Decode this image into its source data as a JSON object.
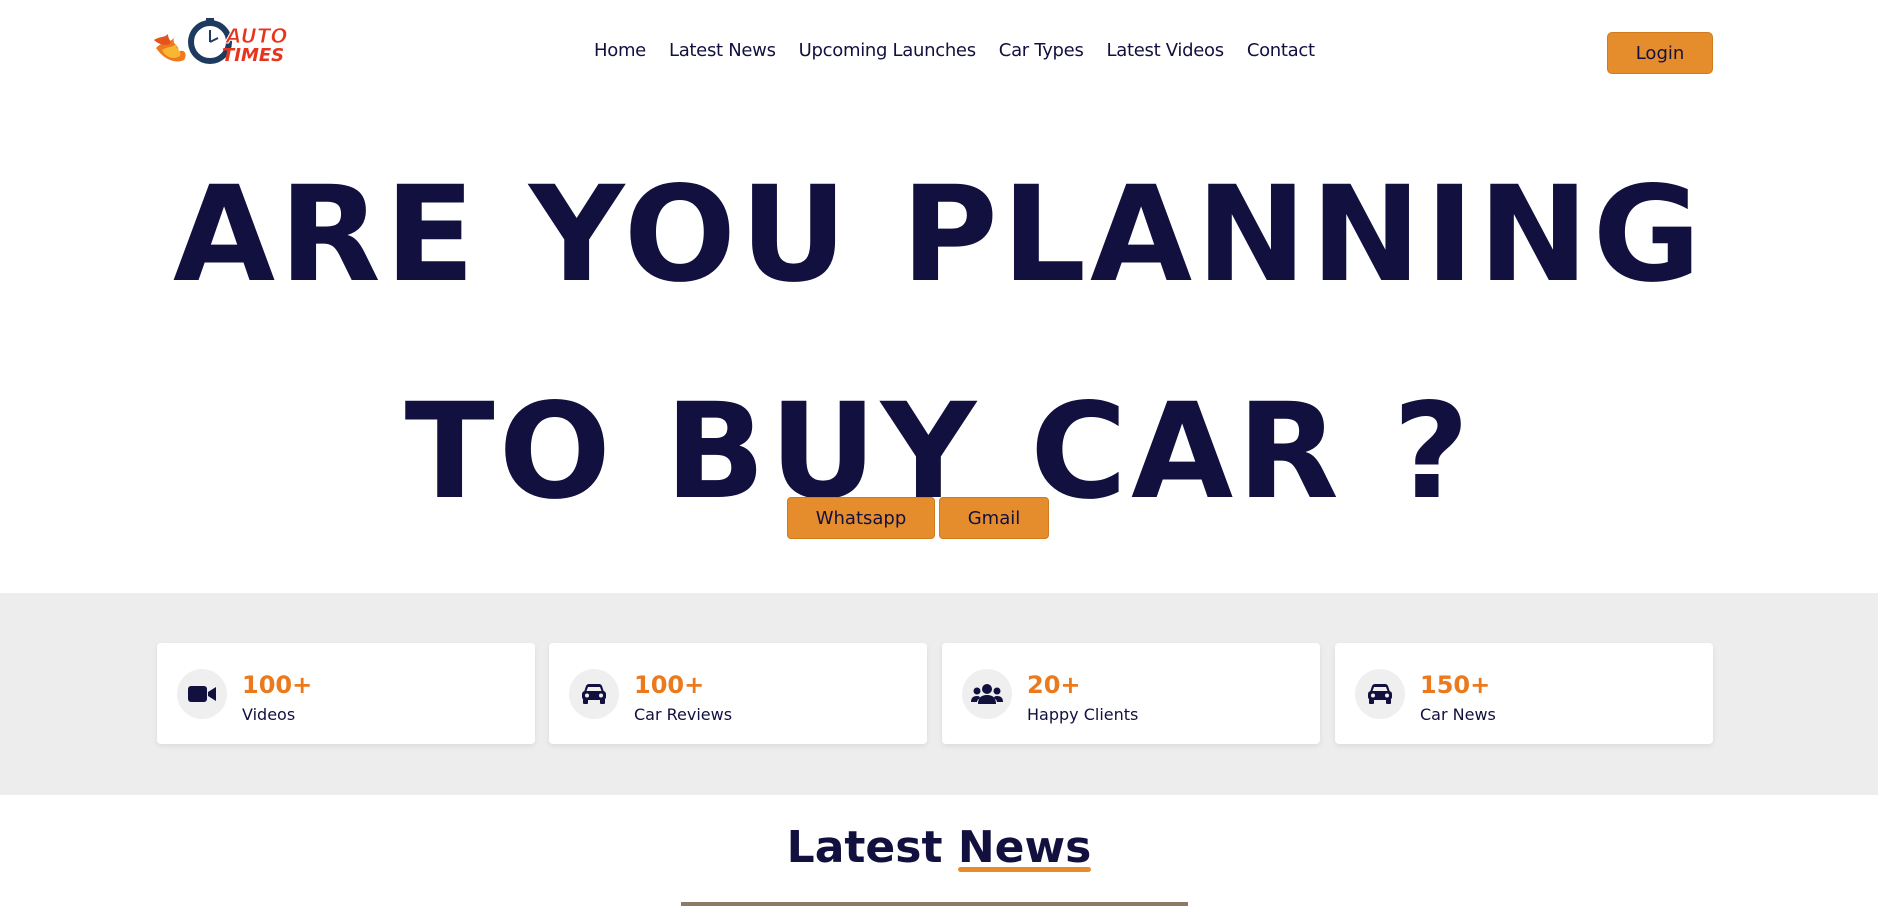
{
  "header": {
    "logo": {
      "alt": "AUTO TIMES",
      "line1": "AUTO",
      "line2": "TIMES"
    },
    "nav": [
      {
        "label": "Home"
      },
      {
        "label": "Latest News"
      },
      {
        "label": "Upcoming Launches"
      },
      {
        "label": "Car Types"
      },
      {
        "label": "Latest Videos"
      },
      {
        "label": "Contact"
      }
    ],
    "login_label": "Login"
  },
  "hero": {
    "line1": "ARE YOU PLANNING",
    "line2": "TO BUY CAR ?",
    "whatsapp_label": "Whatsapp",
    "gmail_label": "Gmail"
  },
  "stats": [
    {
      "value": "100+",
      "label": "Videos",
      "icon": "video-camera-icon"
    },
    {
      "value": "100+",
      "label": "Car Reviews",
      "icon": "car-icon"
    },
    {
      "value": "20+",
      "label": "Happy Clients",
      "icon": "users-icon"
    },
    {
      "value": "150+",
      "label": "Car News",
      "icon": "car-icon"
    }
  ],
  "latest_news": {
    "title_part1": "Latest ",
    "title_part2": "News"
  },
  "colors": {
    "accent": "#e58c2c",
    "navy": "#12103f",
    "stat_orange": "#ea7a1d",
    "band": "#ededed"
  }
}
